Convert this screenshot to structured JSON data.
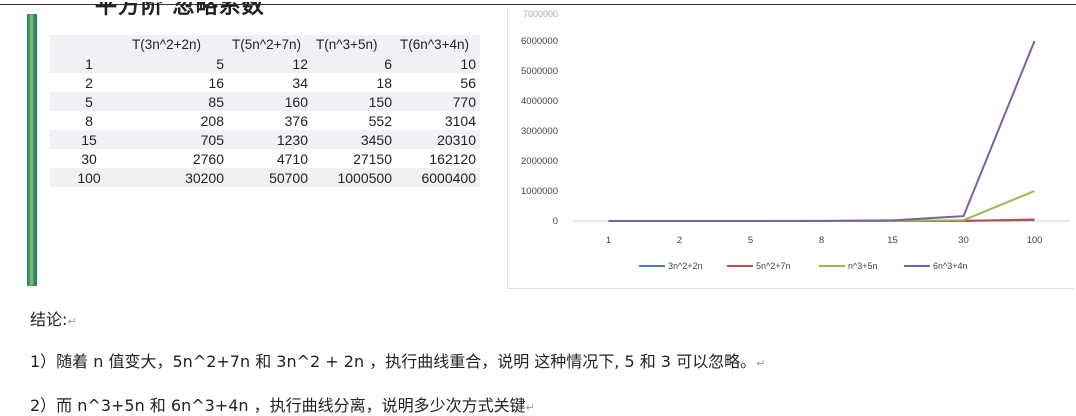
{
  "heading": "平方阶  忽略系数",
  "table": {
    "headers": [
      "",
      "T(3n^2+2n)",
      "T(5n^2+7n)",
      "T(n^3+5n)",
      "T(6n^3+4n)"
    ],
    "rows": [
      [
        "1",
        "5",
        "12",
        "6",
        "10"
      ],
      [
        "2",
        "16",
        "34",
        "18",
        "56"
      ],
      [
        "5",
        "85",
        "160",
        "150",
        "770"
      ],
      [
        "8",
        "208",
        "376",
        "552",
        "3104"
      ],
      [
        "15",
        "705",
        "1230",
        "3450",
        "20310"
      ],
      [
        "30",
        "2760",
        "4710",
        "27150",
        "162120"
      ],
      [
        "100",
        "30200",
        "50700",
        "1000500",
        "6000400"
      ]
    ]
  },
  "chart_data": {
    "type": "line",
    "categories": [
      "1",
      "2",
      "5",
      "8",
      "15",
      "30",
      "100"
    ],
    "series": [
      {
        "name": "3n^2+2n",
        "color": "#4a7ebb",
        "values": [
          5,
          16,
          85,
          208,
          705,
          2760,
          30200
        ]
      },
      {
        "name": "5n^2+7n",
        "color": "#be4b48",
        "values": [
          12,
          34,
          160,
          376,
          1230,
          4710,
          50700
        ]
      },
      {
        "name": "n^3+5n",
        "color": "#98b954",
        "values": [
          6,
          18,
          150,
          552,
          3450,
          27150,
          1000500
        ]
      },
      {
        "name": "6n^3+4n",
        "color": "#7d60a0",
        "values": [
          10,
          56,
          770,
          3104,
          20310,
          162120,
          6000400
        ]
      }
    ],
    "yticks": [
      "0",
      "1000000",
      "2000000",
      "3000000",
      "4000000",
      "5000000",
      "6000000"
    ],
    "ylim": [
      0,
      6000000
    ],
    "grid": false,
    "legend": "bottom"
  },
  "text": {
    "conclusion": "结论:",
    "line1": "1）随着 n 值变大，5n^2+7n  和  3n^2 + 2n ，执行曲线重合，说明   这种情况下, 5 和 3 可以忽略。",
    "line2": "2）而 n^3+5n  和  6n^3+4n   ，执行曲线分离，说明多少次方式关键"
  }
}
